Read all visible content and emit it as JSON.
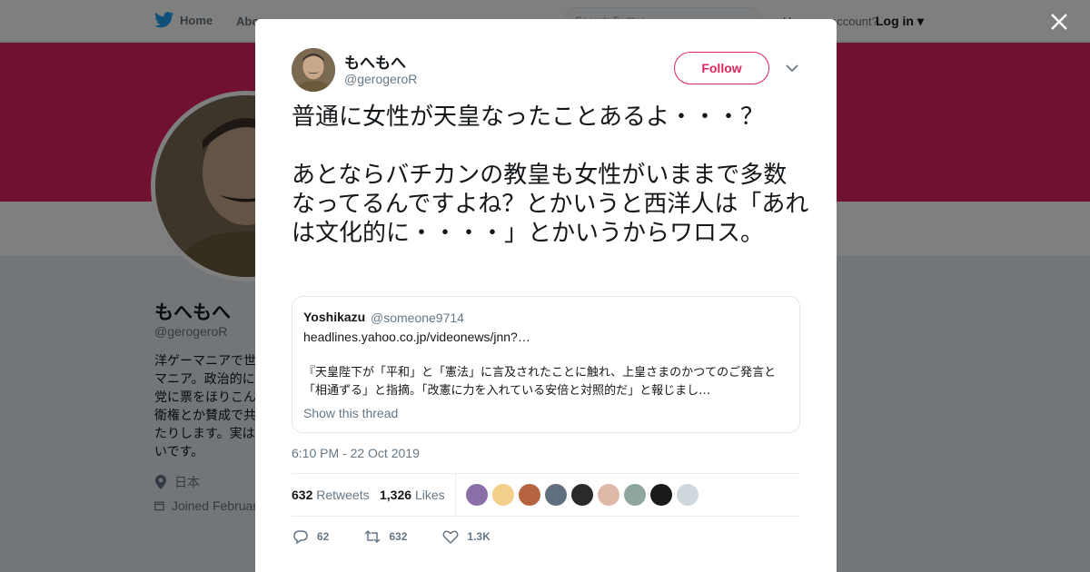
{
  "nav": {
    "home_label": "Home",
    "about_label": "Abo",
    "search_placeholder": "Search Twitter",
    "account_text": "Have an account?",
    "login_label": "Log in"
  },
  "profile": {
    "name": "もへもへ",
    "handle": "@gerogeroR",
    "bio": "洋ゲーマニアで世\nマニア。政治的に\n党に票をほりこん\n衛権とか賛成で共\nたりします。実は\nいです。",
    "location": "日本",
    "joined": "Joined February"
  },
  "tweet": {
    "name": "もへもへ",
    "handle": "@gerogeroR",
    "follow_label": "Follow",
    "text": "普通に女性が天皇なったことあるよ・・・？\n\nあとならバチカンの教皇も女性がいままで多数なってるんですよね？とかいうと西洋人は「あれは文化的に・・・・」とかいうからワロス。",
    "timestamp": "6:10 PM - 22 Oct 2019",
    "retweets_count": "632",
    "retweets_label": "Retweets",
    "likes_count": "1,326",
    "likes_label": "Likes",
    "replies_action": "62",
    "retweets_action": "632",
    "likes_action": "1.3K"
  },
  "quote": {
    "name": "Yoshikazu",
    "handle": "@someone9714",
    "url": "headlines.yahoo.co.jp/videonews/jnn?…",
    "body": "『天皇陛下が「平和」と「憲法」に言及されたことに触れ、上皇さまのかつてのご発言と「相通ずる」と指摘。「改憲に力を入れている安倍と対照的だ」と報じまし…",
    "thread_label": "Show this thread"
  },
  "likers": [
    {
      "icon": "liker-avatar",
      "color": "#8a6fa8"
    },
    {
      "icon": "liker-avatar",
      "color": "#f2d08a"
    },
    {
      "icon": "liker-avatar",
      "color": "#b5643f"
    },
    {
      "icon": "liker-avatar",
      "color": "#5f6f7f"
    },
    {
      "icon": "liker-avatar",
      "color": "#2a2a2a"
    },
    {
      "icon": "liker-avatar",
      "color": "#e0b8a8"
    },
    {
      "icon": "liker-avatar",
      "color": "#8fa5a0"
    },
    {
      "icon": "liker-avatar",
      "color": "#1a1a1a"
    },
    {
      "icon": "liker-avatar",
      "color": "#cfd8dc"
    }
  ],
  "colors": {
    "brand_blue": "#1da1f2",
    "profile_banner": "#e0245e",
    "follow_accent": "#e0245e"
  }
}
